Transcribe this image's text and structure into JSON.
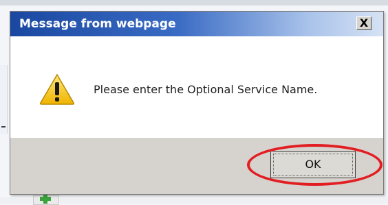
{
  "dialog": {
    "title": "Message from webpage",
    "close_label": "X",
    "message": "Please enter the Optional Service Name.",
    "ok_label": "OK",
    "icon": "warning-icon"
  },
  "colors": {
    "title_gradient_start": "#1a48a0",
    "title_gradient_end": "#d6e2f4",
    "highlight": "#e21e22",
    "warning_yellow": "#f5c518"
  }
}
